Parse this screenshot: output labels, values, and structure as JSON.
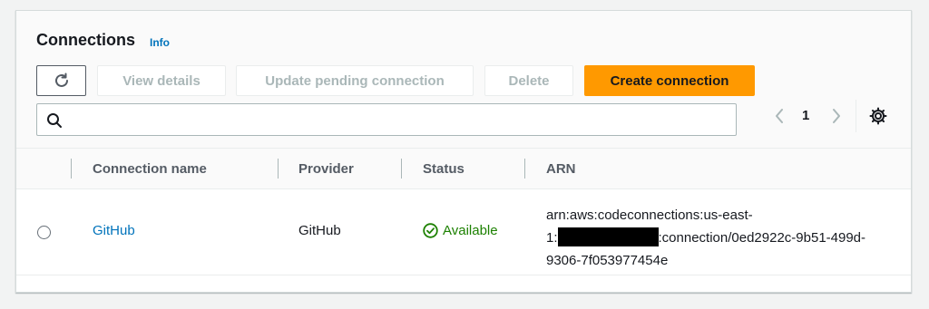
{
  "header": {
    "title": "Connections",
    "info_link": "Info"
  },
  "toolbar": {
    "refresh_icon": "refresh-icon",
    "view_details_label": "View details",
    "update_pending_label": "Update pending connection",
    "delete_label": "Delete",
    "create_label": "Create connection"
  },
  "search": {
    "icon": "search-icon",
    "value": "",
    "placeholder": ""
  },
  "pagination": {
    "current_page": "1"
  },
  "table": {
    "columns": [
      "Connection name",
      "Provider",
      "Status",
      "ARN"
    ],
    "rows": [
      {
        "connection_name": "GitHub",
        "provider": "GitHub",
        "status": "Available",
        "arn_prefix": "arn:aws:codeconnections:us-east-1:",
        "arn_line1": "arn:aws:codeconnections:us-east-",
        "arn_line2_start": "1:",
        "arn_line2_end": ":connection/0ed2922c-9b51-499d-",
        "arn_line3": "9306-7f053977454e"
      }
    ]
  },
  "colors": {
    "primary_button": "#ff9900",
    "link": "#0073bb",
    "status_available": "#1d8102"
  }
}
